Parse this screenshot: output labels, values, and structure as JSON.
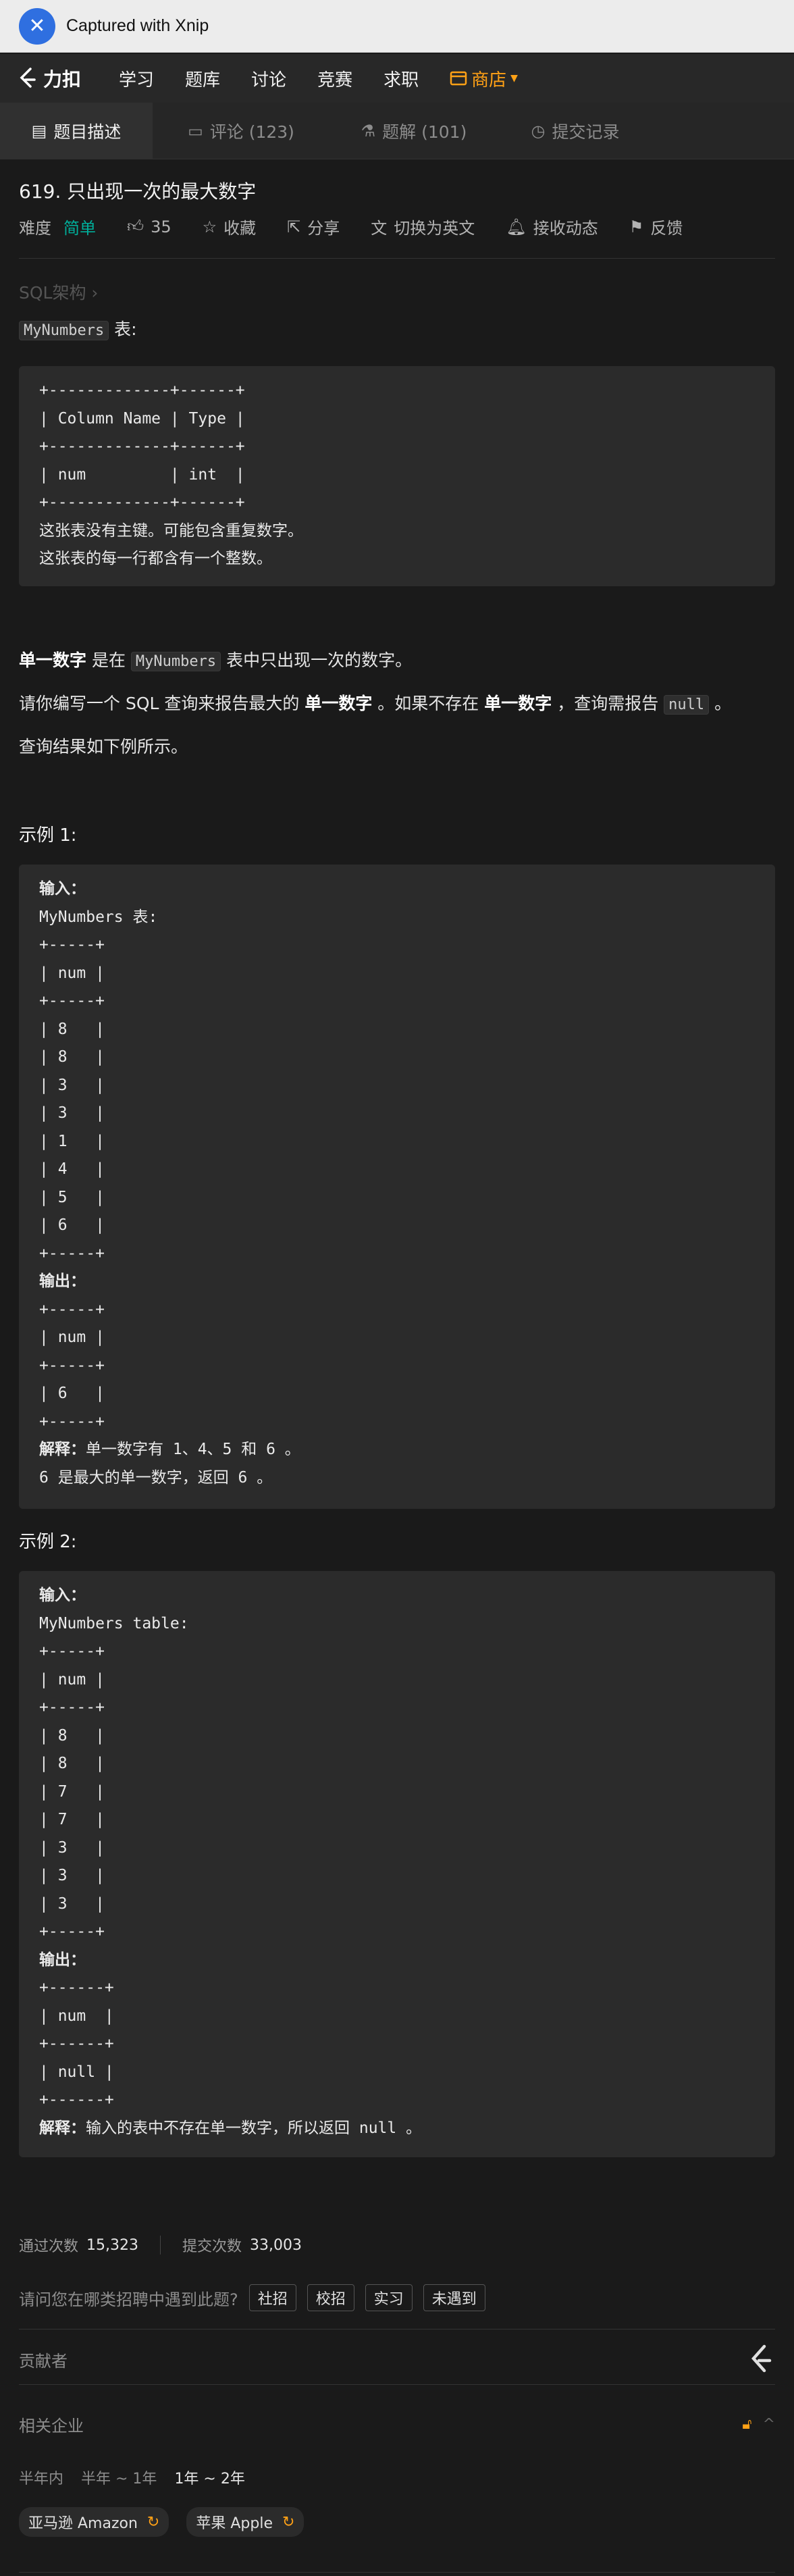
{
  "capture_bar": {
    "title": "Captured with Xnip"
  },
  "nav": {
    "brand": "力扣",
    "items": [
      "学习",
      "题库",
      "讨论",
      "竞赛",
      "求职"
    ],
    "shop": "商店"
  },
  "tabs": [
    "题目描述",
    "评论 (123)",
    "题解 (101)",
    "提交记录"
  ],
  "problem": {
    "title": "619. 只出现一次的最大数字",
    "difficulty_label": "难度",
    "difficulty": "简单",
    "likes": "35",
    "favorite": "收藏",
    "share": "分享",
    "switch_lang": "切换为英文",
    "notify": "接收动态",
    "feedback": "反馈",
    "breadcrumb": "SQL架构 ›"
  },
  "schema": {
    "table_name": "MyNumbers",
    "suffix": " 表:",
    "code": "+-------------+------+\n| Column Name | Type |\n+-------------+------+\n| num         | int  |\n+-------------+------+",
    "notes": [
      "这张表没有主键。可能包含重复数字。",
      "这张表的每一行都含有一个整数。"
    ]
  },
  "description": {
    "p1_a": "单一数字",
    "p1_b": " 是在 ",
    "p1_code": "MyNumbers",
    "p1_c": " 表中只出现一次的数字。",
    "p2_a": "请你编写一个 SQL 查询来报告最大的 ",
    "p2_b": "单一数字",
    "p2_c": " 。如果不存在 ",
    "p2_d": "单一数字",
    "p2_e": " ，查询需报告 ",
    "p2_code": "null",
    "p2_f": " 。",
    "p3": "查询结果如下例所示。"
  },
  "example1": {
    "heading": "示例 1:",
    "input_label": "输入：",
    "table_label": "MyNumbers 表:",
    "input_code": "+-----+\n| num |\n+-----+\n| 8   |\n| 8   |\n| 3   |\n| 3   |\n| 1   |\n| 4   |\n| 5   |\n| 6   |\n+-----+",
    "output_label": "输出：",
    "output_code": "+-----+\n| num |\n+-----+\n| 6   |\n+-----+",
    "explain_label": "解释：",
    "explain_1": "单一数字有 1、4、5 和 6 。",
    "explain_2": "6 是最大的单一数字，返回 6 。"
  },
  "example2": {
    "heading": "示例 2:",
    "input_label": "输入：",
    "table_label": "MyNumbers table:",
    "input_code": "+-----+\n| num |\n+-----+\n| 8   |\n| 8   |\n| 7   |\n| 7   |\n| 3   |\n| 3   |\n| 3   |\n+-----+",
    "output_label": "输出：",
    "output_code": "+------+\n| num  |\n+------+\n| null |\n+------+",
    "explain_label": "解释：",
    "explain_1": "输入的表中不存在单一数字，所以返回 null 。"
  },
  "stats": {
    "accepted_label": "通过次数",
    "accepted": "15,323",
    "submitted_label": "提交次数",
    "submitted": "33,003"
  },
  "hiring": {
    "question": "请问您在哪类招聘中遇到此题?",
    "options": [
      "社招",
      "校招",
      "实习",
      "未遇到"
    ]
  },
  "contributors": {
    "label": "贡献者"
  },
  "companies": {
    "label": "相关企业",
    "ranges": [
      "半年内",
      "半年 ~ 1年",
      "1年 ~ 2年"
    ],
    "items": [
      "亚马逊 Amazon",
      "苹果 Apple"
    ]
  },
  "colors": {
    "accent": "#ffa116",
    "easy": "#00af9b",
    "background": "#1a1a1a"
  }
}
